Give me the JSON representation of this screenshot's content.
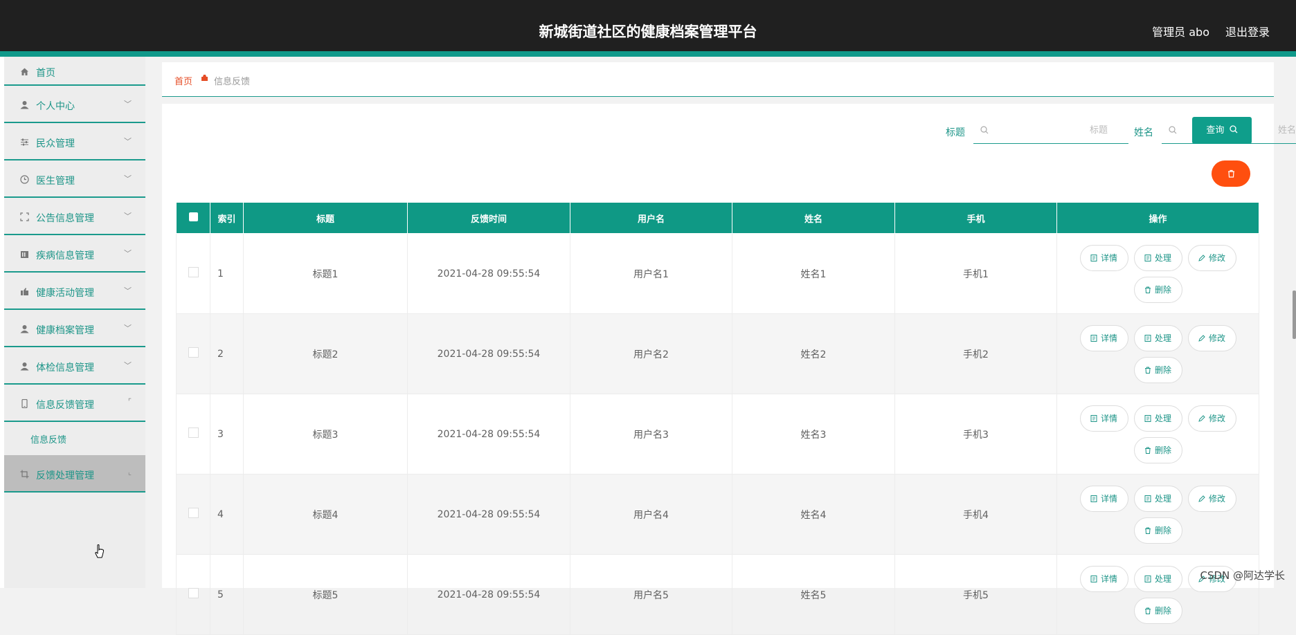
{
  "header": {
    "title": "新城街道社区的健康档案管理平台",
    "user": "管理员 abo",
    "logout": "退出登录"
  },
  "sidebar": {
    "items": [
      {
        "label": "首页",
        "icon": "home-icon"
      },
      {
        "label": "个人中心",
        "icon": "user-icon"
      },
      {
        "label": "民众管理",
        "icon": "sliders-icon"
      },
      {
        "label": "医生管理",
        "icon": "clock-icon"
      },
      {
        "label": "公告信息管理",
        "icon": "frame-icon"
      },
      {
        "label": "疾病信息管理",
        "icon": "building-icon"
      },
      {
        "label": "健康活动管理",
        "icon": "thumb-icon"
      },
      {
        "label": "健康档案管理",
        "icon": "user-icon"
      },
      {
        "label": "体检信息管理",
        "icon": "user-icon"
      },
      {
        "label": "信息反馈管理",
        "icon": "phone-icon"
      },
      {
        "label": "反馈处理管理",
        "icon": "crop-icon"
      }
    ],
    "sub_item": "信息反馈"
  },
  "breadcrumb": {
    "home": "首页",
    "current": "信息反馈"
  },
  "search": {
    "title_label": "标题",
    "title_placeholder": "标题",
    "name_label": "姓名",
    "name_placeholder": "姓名",
    "query_button": "查询"
  },
  "table": {
    "headers": [
      "索引",
      "标题",
      "反馈时间",
      "用户名",
      "姓名",
      "手机",
      "操作"
    ],
    "rows": [
      {
        "index": "1",
        "title": "标题1",
        "time": "2021-04-28 09:55:54",
        "username": "用户名1",
        "name": "姓名1",
        "phone": "手机1"
      },
      {
        "index": "2",
        "title": "标题2",
        "time": "2021-04-28 09:55:54",
        "username": "用户名2",
        "name": "姓名2",
        "phone": "手机2"
      },
      {
        "index": "3",
        "title": "标题3",
        "time": "2021-04-28 09:55:54",
        "username": "用户名3",
        "name": "姓名3",
        "phone": "手机3"
      },
      {
        "index": "4",
        "title": "标题4",
        "time": "2021-04-28 09:55:54",
        "username": "用户名4",
        "name": "姓名4",
        "phone": "手机4"
      },
      {
        "index": "5",
        "title": "标题5",
        "time": "2021-04-28 09:55:54",
        "username": "用户名5",
        "name": "姓名5",
        "phone": "手机5"
      }
    ],
    "ops": {
      "detail": "详情",
      "process": "处理",
      "edit": "修改",
      "delete": "删除"
    }
  },
  "watermark": "CSDN @阿达学长",
  "colors": {
    "header_bg": "#202020",
    "accent": "#0f9985",
    "danger": "#ff4f0f",
    "link": "#e54d26"
  }
}
